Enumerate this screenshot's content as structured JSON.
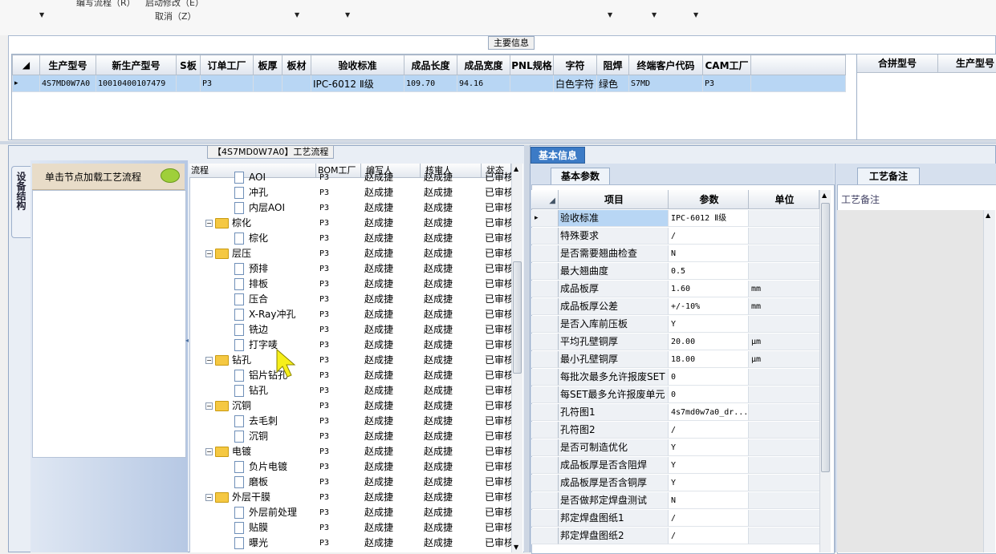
{
  "toolbar": {
    "item1": "编写流程（R）",
    "item2": "启动修改（E）",
    "item3": "取消（Z）"
  },
  "main_info": {
    "title": "主要信息",
    "columns": [
      "生产型号",
      "新生产型号",
      "S板",
      "订单工厂",
      "板厚",
      "板材",
      "验收标准",
      "成品长度",
      "成品宽度",
      "PNL规格",
      "字符",
      "阻焊",
      "终端客户代码",
      "CAM工厂"
    ],
    "rows": [
      [
        "4S7MD0W7A0",
        "10010400107479",
        "",
        "P3",
        "",
        "",
        "IPC-6012 Ⅱ级",
        "109.70",
        "94.16",
        "",
        "白色字符",
        "绿色",
        "S7MD",
        "P3"
      ]
    ],
    "right_columns": [
      "合拼型号",
      "生产型号"
    ]
  },
  "left_panel": {
    "vtab": "设备结构",
    "node_hint": "单击节点加载工艺流程"
  },
  "process_flow": {
    "title": "【4S7MD0W7A0】工艺流程",
    "columns": [
      "流程",
      "BOM工厂",
      "编写人",
      "核审人",
      "状态"
    ],
    "rows": [
      {
        "level": 2,
        "name": "AOI",
        "bom": "P3",
        "writer": "赵成捷",
        "checker": "赵成捷",
        "status": "已审核"
      },
      {
        "level": 2,
        "name": "冲孔",
        "bom": "P3",
        "writer": "赵成捷",
        "checker": "赵成捷",
        "status": "已审核"
      },
      {
        "level": 2,
        "name": "内层AOI",
        "bom": "P3",
        "writer": "赵成捷",
        "checker": "赵成捷",
        "status": "已审核"
      },
      {
        "level": 1,
        "name": "棕化",
        "bom": "P3",
        "writer": "赵成捷",
        "checker": "赵成捷",
        "status": "已审核"
      },
      {
        "level": 2,
        "name": "棕化",
        "bom": "P3",
        "writer": "赵成捷",
        "checker": "赵成捷",
        "status": "已审核"
      },
      {
        "level": 1,
        "name": "层压",
        "bom": "P3",
        "writer": "赵成捷",
        "checker": "赵成捷",
        "status": "已审核"
      },
      {
        "level": 2,
        "name": "预排",
        "bom": "P3",
        "writer": "赵成捷",
        "checker": "赵成捷",
        "status": "已审核"
      },
      {
        "level": 2,
        "name": "排板",
        "bom": "P3",
        "writer": "赵成捷",
        "checker": "赵成捷",
        "status": "已审核"
      },
      {
        "level": 2,
        "name": "压合",
        "bom": "P3",
        "writer": "赵成捷",
        "checker": "赵成捷",
        "status": "已审核"
      },
      {
        "level": 2,
        "name": "X-Ray冲孔",
        "bom": "P3",
        "writer": "赵成捷",
        "checker": "赵成捷",
        "status": "已审核"
      },
      {
        "level": 2,
        "name": "铣边",
        "bom": "P3",
        "writer": "赵成捷",
        "checker": "赵成捷",
        "status": "已审核"
      },
      {
        "level": 2,
        "name": "打字唛",
        "bom": "P3",
        "writer": "赵成捷",
        "checker": "赵成捷",
        "status": "已审核"
      },
      {
        "level": 1,
        "name": "钻孔",
        "bom": "P3",
        "writer": "赵成捷",
        "checker": "赵成捷",
        "status": "已审核"
      },
      {
        "level": 2,
        "name": "铝片钻孔",
        "bom": "P3",
        "writer": "赵成捷",
        "checker": "赵成捷",
        "status": "已审核"
      },
      {
        "level": 2,
        "name": "钻孔",
        "bom": "P3",
        "writer": "赵成捷",
        "checker": "赵成捷",
        "status": "已审核"
      },
      {
        "level": 1,
        "name": "沉铜",
        "bom": "P3",
        "writer": "赵成捷",
        "checker": "赵成捷",
        "status": "已审核"
      },
      {
        "level": 2,
        "name": "去毛刺",
        "bom": "P3",
        "writer": "赵成捷",
        "checker": "赵成捷",
        "status": "已审核"
      },
      {
        "level": 2,
        "name": "沉铜",
        "bom": "P3",
        "writer": "赵成捷",
        "checker": "赵成捷",
        "status": "已审核"
      },
      {
        "level": 1,
        "name": "电镀",
        "bom": "P3",
        "writer": "赵成捷",
        "checker": "赵成捷",
        "status": "已审核"
      },
      {
        "level": 2,
        "name": "负片电镀",
        "bom": "P3",
        "writer": "赵成捷",
        "checker": "赵成捷",
        "status": "已审核"
      },
      {
        "level": 2,
        "name": "磨板",
        "bom": "P3",
        "writer": "赵成捷",
        "checker": "赵成捷",
        "status": "已审核"
      },
      {
        "level": 1,
        "name": "外层干膜",
        "bom": "P3",
        "writer": "赵成捷",
        "checker": "赵成捷",
        "status": "已审核"
      },
      {
        "level": 2,
        "name": "外层前处理",
        "bom": "P3",
        "writer": "赵成捷",
        "checker": "赵成捷",
        "status": "已审核"
      },
      {
        "level": 2,
        "name": "贴膜",
        "bom": "P3",
        "writer": "赵成捷",
        "checker": "赵成捷",
        "status": "已审核"
      },
      {
        "level": 2,
        "name": "曝光",
        "bom": "P3",
        "writer": "赵成捷",
        "checker": "赵成捷",
        "status": "已审核"
      }
    ]
  },
  "basic_info": {
    "tab": "基本信息",
    "subtab": "基本参数",
    "columns": [
      "项目",
      "参数",
      "单位"
    ],
    "rows": [
      {
        "item": "验收标准",
        "param": "IPC-6012 Ⅱ级",
        "unit": ""
      },
      {
        "item": "特殊要求",
        "param": "/",
        "unit": ""
      },
      {
        "item": "是否需要翘曲检查",
        "param": "N",
        "unit": ""
      },
      {
        "item": "最大翘曲度",
        "param": "0.5",
        "unit": ""
      },
      {
        "item": "成品板厚",
        "param": "1.60",
        "unit": "mm"
      },
      {
        "item": "成品板厚公差",
        "param": "+/-10%",
        "unit": "mm"
      },
      {
        "item": "是否入库前压板",
        "param": "Y",
        "unit": ""
      },
      {
        "item": "平均孔壁铜厚",
        "param": "20.00",
        "unit": "μm"
      },
      {
        "item": "最小孔壁铜厚",
        "param": "18.00",
        "unit": "μm"
      },
      {
        "item": "每批次最多允许报废SET",
        "param": "0",
        "unit": ""
      },
      {
        "item": "每SET最多允许报废单元",
        "param": "0",
        "unit": ""
      },
      {
        "item": "孔符图1",
        "param": "4s7md0w7a0_dr...",
        "unit": ""
      },
      {
        "item": "孔符图2",
        "param": "/",
        "unit": ""
      },
      {
        "item": "是否可制造优化",
        "param": "Y",
        "unit": ""
      },
      {
        "item": "成品板厚是否含阻焊",
        "param": "Y",
        "unit": ""
      },
      {
        "item": "成品板厚是否含铜厚",
        "param": "Y",
        "unit": ""
      },
      {
        "item": "是否做邦定焊盘测试",
        "param": "N",
        "unit": ""
      },
      {
        "item": "邦定焊盘图纸1",
        "param": "/",
        "unit": ""
      },
      {
        "item": "邦定焊盘图纸2",
        "param": "/",
        "unit": ""
      }
    ]
  },
  "remarks": {
    "tab": "工艺备注",
    "label": "工艺备注"
  },
  "colors": {
    "selection": "#b8d6f4",
    "tab_active": "#3c7bc6",
    "folder": "#f5c842"
  }
}
